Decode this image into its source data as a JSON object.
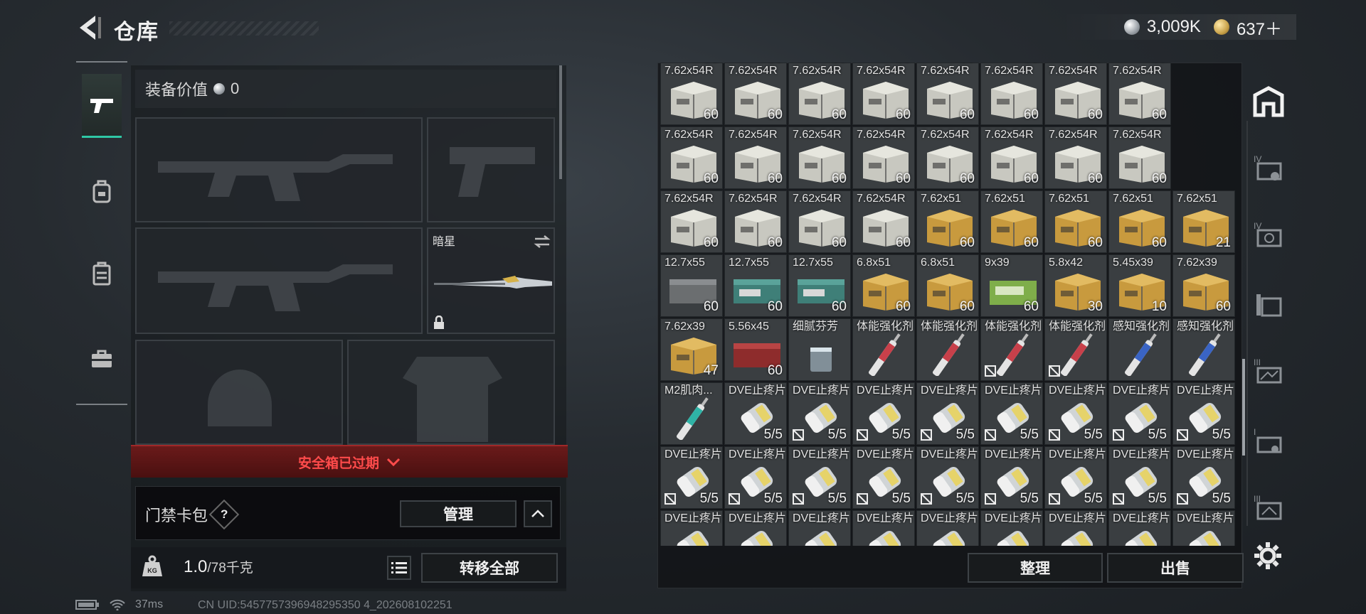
{
  "header": {
    "title": "仓库",
    "currency": [
      {
        "icon": "silver-coin-icon",
        "value": "3,009K"
      },
      {
        "icon": "gold-coin-icon",
        "value": "637＋"
      }
    ]
  },
  "sidebar": {
    "tabs": [
      {
        "icon": "gun-icon",
        "active": true
      },
      {
        "icon": "backpack-icon",
        "active": false
      },
      {
        "icon": "vest-icon",
        "active": false
      },
      {
        "icon": "briefcase-icon",
        "active": false
      }
    ]
  },
  "equipment": {
    "label": "装备价值",
    "value": "0",
    "melee_name": "暗星"
  },
  "safebox": {
    "text": "安全箱已过期"
  },
  "keycard": {
    "label": "门禁卡包",
    "help": "?",
    "manage": "管理"
  },
  "weight": {
    "current": "1.0",
    "max": "/78千克"
  },
  "transfer_all": "转移全部",
  "status": {
    "ping": "37ms",
    "uid": "CN UID:5457757396948295350 4_202608102251"
  },
  "inventory": {
    "rows": [
      {
        "items": [
          {
            "q": "60",
            "k": "ammo"
          },
          {
            "q": "60",
            "k": "ammo"
          },
          {
            "q": "60",
            "k": "ammo"
          },
          {
            "q": "60",
            "k": "ammo"
          },
          {
            "q": "60",
            "k": "ammo"
          },
          {
            "q": "60",
            "k": "ammo"
          },
          {
            "q": "60",
            "k": "ammo"
          },
          {
            "q": "60",
            "k": "ammo"
          }
        ]
      },
      {
        "items": [
          {
            "n": "7.62x54R",
            "q": "60",
            "k": "ammo"
          },
          {
            "n": "7.62x54R",
            "q": "60",
            "k": "ammo"
          },
          {
            "n": "7.62x54R",
            "q": "60",
            "k": "ammo"
          },
          {
            "n": "7.62x54R",
            "q": "60",
            "k": "ammo"
          },
          {
            "n": "7.62x54R",
            "q": "60",
            "k": "ammo"
          },
          {
            "n": "7.62x54R",
            "q": "60",
            "k": "ammo"
          },
          {
            "n": "7.62x54R",
            "q": "60",
            "k": "ammo"
          },
          {
            "n": "7.62x54R",
            "q": "60",
            "k": "ammo"
          }
        ]
      },
      {
        "items": [
          {
            "n": "7.62x54R",
            "q": "60",
            "k": "ammo"
          },
          {
            "n": "7.62x54R",
            "q": "60",
            "k": "ammo"
          },
          {
            "n": "7.62x54R",
            "q": "60",
            "k": "ammo"
          },
          {
            "n": "7.62x54R",
            "q": "60",
            "k": "ammo"
          },
          {
            "n": "7.62x54R",
            "q": "60",
            "k": "ammo"
          },
          {
            "n": "7.62x54R",
            "q": "60",
            "k": "ammo"
          },
          {
            "n": "7.62x54R",
            "q": "60",
            "k": "ammo"
          },
          {
            "n": "7.62x54R",
            "q": "60",
            "k": "ammo"
          }
        ]
      },
      {
        "items": [
          {
            "n": "7.62x54R",
            "q": "60",
            "k": "ammo"
          },
          {
            "n": "7.62x54R",
            "q": "60",
            "k": "ammo"
          },
          {
            "n": "7.62x54R",
            "q": "60",
            "k": "ammo"
          },
          {
            "n": "7.62x54R",
            "q": "60",
            "k": "ammo"
          },
          {
            "n": "7.62x51",
            "q": "60",
            "k": "ammo-gold"
          },
          {
            "n": "7.62x51",
            "q": "60",
            "k": "ammo-gold"
          },
          {
            "n": "7.62x51",
            "q": "60",
            "k": "ammo-gold"
          },
          {
            "n": "7.62x51",
            "q": "60",
            "k": "ammo-gold"
          },
          {
            "n": "7.62x51",
            "q": "21",
            "k": "ammo-gold"
          }
        ]
      },
      {
        "items": [
          {
            "n": "12.7x55",
            "q": "60",
            "k": "ammo-gray"
          },
          {
            "n": "12.7x55",
            "q": "60",
            "k": "ammo-teal"
          },
          {
            "n": "12.7x55",
            "q": "60",
            "k": "ammo-teal"
          },
          {
            "n": "6.8x51",
            "q": "60",
            "k": "ammo-gold"
          },
          {
            "n": "6.8x51",
            "q": "60",
            "k": "ammo-gold"
          },
          {
            "n": "9x39",
            "q": "60",
            "k": "ammo-green"
          },
          {
            "n": "5.8x42",
            "q": "30",
            "k": "ammo-gold"
          },
          {
            "n": "5.45x39",
            "q": "10",
            "k": "ammo-gold"
          },
          {
            "n": "7.62x39",
            "q": "60",
            "k": "ammo-gold"
          }
        ]
      },
      {
        "items": [
          {
            "n": "7.62x39",
            "q": "47",
            "k": "ammo-gold"
          },
          {
            "n": "5.56x45",
            "q": "60",
            "k": "ammo-red"
          },
          {
            "n": "细腻芬芳",
            "q": "",
            "k": "glass"
          },
          {
            "n": "体能强化剂",
            "q": "",
            "k": "syr-red"
          },
          {
            "n": "体能强化剂",
            "q": "",
            "k": "syr-red"
          },
          {
            "n": "体能强化剂",
            "q": "",
            "k": "syr-red",
            "lock": true
          },
          {
            "n": "体能强化剂",
            "q": "",
            "k": "syr-red",
            "lock": true
          },
          {
            "n": "感知强化剂",
            "q": "",
            "k": "syr-blue"
          },
          {
            "n": "感知强化剂",
            "q": "",
            "k": "syr-blue"
          }
        ]
      },
      {
        "items": [
          {
            "n": "M2肌肉...",
            "q": "",
            "k": "syr-teal"
          },
          {
            "n": "DVE止疼片",
            "q": "5/5",
            "k": "pill"
          },
          {
            "n": "DVE止疼片",
            "q": "5/5",
            "k": "pill",
            "lock": true
          },
          {
            "n": "DVE止疼片",
            "q": "5/5",
            "k": "pill",
            "lock": true
          },
          {
            "n": "DVE止疼片",
            "q": "5/5",
            "k": "pill",
            "lock": true
          },
          {
            "n": "DVE止疼片",
            "q": "5/5",
            "k": "pill",
            "lock": true
          },
          {
            "n": "DVE止疼片",
            "q": "5/5",
            "k": "pill",
            "lock": true
          },
          {
            "n": "DVE止疼片",
            "q": "5/5",
            "k": "pill",
            "lock": true
          },
          {
            "n": "DVE止疼片",
            "q": "5/5",
            "k": "pill",
            "lock": true
          }
        ]
      },
      {
        "items": [
          {
            "n": "DVE止疼片",
            "q": "5/5",
            "k": "pill",
            "lock": true
          },
          {
            "n": "DVE止疼片",
            "q": "5/5",
            "k": "pill",
            "lock": true
          },
          {
            "n": "DVE止疼片",
            "q": "5/5",
            "k": "pill",
            "lock": true
          },
          {
            "n": "DVE止疼片",
            "q": "5/5",
            "k": "pill",
            "lock": true
          },
          {
            "n": "DVE止疼片",
            "q": "5/5",
            "k": "pill",
            "lock": true
          },
          {
            "n": "DVE止疼片",
            "q": "5/5",
            "k": "pill",
            "lock": true
          },
          {
            "n": "DVE止疼片",
            "q": "5/5",
            "k": "pill",
            "lock": true
          },
          {
            "n": "DVE止疼片",
            "q": "5/5",
            "k": "pill",
            "lock": true
          },
          {
            "n": "DVE止疼片",
            "q": "5/5",
            "k": "pill",
            "lock": true
          }
        ]
      },
      {
        "items": [
          {
            "n": "DVE止疼片",
            "q": "",
            "k": "pill"
          },
          {
            "n": "DVE止疼片",
            "q": "",
            "k": "pill"
          },
          {
            "n": "DVE止疼片",
            "q": "",
            "k": "pill"
          },
          {
            "n": "DVE止疼片",
            "q": "",
            "k": "pill"
          },
          {
            "n": "DVE止疼片",
            "q": "",
            "k": "pill"
          },
          {
            "n": "DVE止疼片",
            "q": "",
            "k": "pill"
          },
          {
            "n": "DVE止疼片",
            "q": "",
            "k": "pill"
          },
          {
            "n": "DVE止疼片",
            "q": "",
            "k": "pill"
          },
          {
            "n": "DVE止疼片",
            "q": "",
            "k": "pill"
          }
        ]
      }
    ],
    "sort": "整理",
    "sell": "出售"
  },
  "rail": {
    "icons": [
      "storage-icon",
      "map-iv-icon",
      "map-iv-2-icon",
      "map-iii-icon",
      "map-ii-icon",
      "map-i-icon",
      "map-extra-icon"
    ]
  },
  "colors": {
    "accent": "#2fc7a5",
    "alert": "#ff4b4b",
    "gold": "#c9a24a"
  }
}
